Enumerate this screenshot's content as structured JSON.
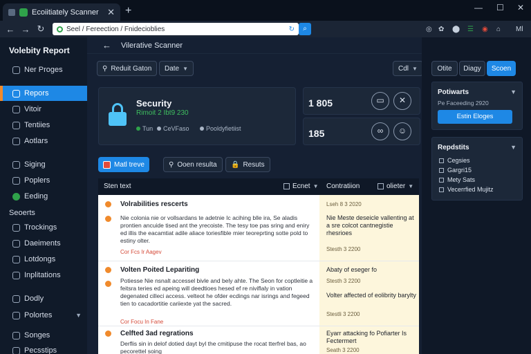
{
  "browser": {
    "tab_title": "Ecoiitiately Scanner",
    "url": "Seel / Fereection / Fnidecioblies",
    "go_label": "⌕",
    "extensions": [
      "◎",
      "✿",
      "⬤",
      "☰",
      "◉",
      "⌂",
      "Ml"
    ]
  },
  "sidebar": {
    "brand": "Volebity Report",
    "items": [
      {
        "label": "Ner Proges"
      },
      {
        "label": "Repors"
      },
      {
        "label": "Vitoir"
      },
      {
        "label": "Tentiies"
      },
      {
        "label": "Aotlars"
      },
      {
        "label": "Siging"
      },
      {
        "label": "Poplers"
      },
      {
        "label": "Eeding"
      },
      {
        "label": "Trockings"
      },
      {
        "label": "Daeiments"
      },
      {
        "label": "Lotdongs"
      },
      {
        "label": "Inplitations"
      },
      {
        "label": "Dodly"
      },
      {
        "label": "Polortes"
      },
      {
        "label": "Songes"
      },
      {
        "label": "Pecsstips"
      }
    ],
    "section_label": "Seoerts"
  },
  "main": {
    "header_title": "Vilerative Scanner",
    "search_btn": "Reduit Gaton",
    "date_btn": "Date",
    "cal_btn": "Cdl",
    "security": {
      "title": "Security",
      "subtitle": "Rimoit 2 Ibt9 230",
      "meta1": "Tun",
      "meta2": "CeVFaso",
      "meta3": "Pooldyfietiist"
    },
    "stats": [
      {
        "value": "1 805"
      },
      {
        "value": "185"
      }
    ],
    "pills": {
      "main": "Matl treve",
      "search": "Ooen resulta",
      "results": "Resuts"
    },
    "table": {
      "col1": "Sten text",
      "col2": "Ecnet",
      "col3": "Contratiion",
      "col4": "olieter",
      "rows": [
        {
          "title": "Volrabilities rescerts",
          "body": "Nie colonia nie or vollsardans te adetnie Ic acihing blle ira, Se aladis prontien ancuide tised ant the yrecoiste. The tesy toe pas sring and eniry ed illis the eacamtiat adile aliace toriesfible mier teoreprting sotte pold to estiny olter.",
          "link": "Cor Fcs Ir Aagev",
          "side_title": "Lseh 8 3 2020",
          "side_date": ""
        },
        {
          "title": "",
          "body": "",
          "link": "",
          "side_title": "Nie Meste deseicle vallenting at a sre colcot cantnegistie rhesrioes",
          "side_date": "Stesth 3 2200"
        },
        {
          "title": "Volten Poited Lepariting",
          "body": "Potiesse Nie nsnalt accessel bivle and bely ahte. The Seon for coptleitie a feitsra teries ed apeing will deedtioes hesed ef re niviflaly in vation degenated cilleci access. velteot he ofder ecdings nar isrings and fegeed tien to cacadortitie cariiexte yat the sacred.",
          "link": "Cor Focu In Fane",
          "side_title": "Abaty of eseger fo",
          "side_date": "Stesth 3 2200"
        },
        {
          "title": "",
          "body": "",
          "link": "",
          "side_title": "Volter affected of eolibrity barylty",
          "side_date": "Stestli 3 2200"
        },
        {
          "title": "Celfted 3ad regrations",
          "body": "Derflis sin in delof dotied dayt byl the cmitipuse the rocat tterfrel bas, ao pecorettel soing",
          "link": "",
          "side_title": "Eyarr attacking fo Pofiarter Is Fectermert",
          "side_date": "Seath 3 2200"
        }
      ]
    }
  },
  "right": {
    "btn1": "Otite",
    "btn2": "Diagy",
    "btn3": "Scoen",
    "card1": {
      "title": "Potiwarts",
      "subtitle": "Pe Faceeding 2920",
      "button": "Estin Eloges"
    },
    "card2": {
      "title": "Repdstits",
      "items": [
        "Cegsies",
        "Gargri15",
        "Mety Sats",
        "Vecerrfied Mujitz"
      ]
    }
  },
  "colors": {
    "accent": "#1e88e5",
    "success": "#2fa24a",
    "warning": "#f08a2c",
    "danger": "#e24b3b"
  }
}
